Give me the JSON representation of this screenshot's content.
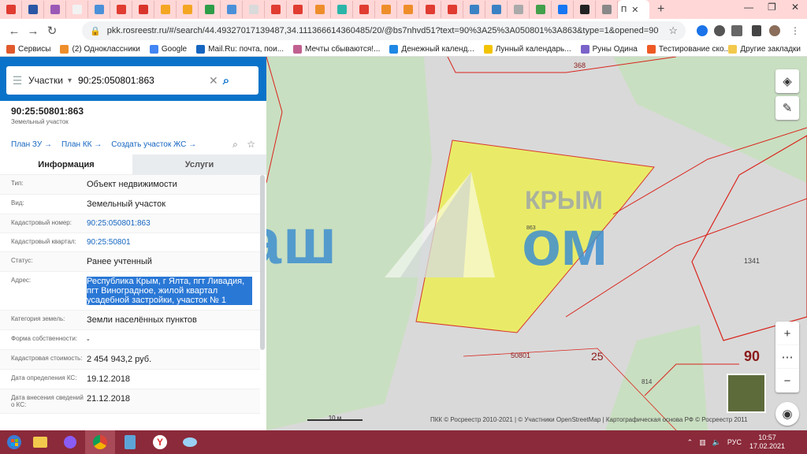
{
  "browser": {
    "tab_favicons": [
      "#e03c31",
      "#2a56a5",
      "#9b59b6",
      "#f2f2f2",
      "#4a90d9",
      "#e03c31",
      "#d9342b",
      "#f4a623",
      "#f4a623",
      "#2e9d48",
      "#4a90d9",
      "#dadada",
      "#e03c31",
      "#e03c31",
      "#ee8e2b",
      "#2bb5a8",
      "#e03c31",
      "#ee8e2b",
      "#ee8e2b",
      "#e03c31",
      "#e03c31",
      "#3b82c4",
      "#3b82c4",
      "#aaaaaa",
      "#42a04b",
      "#1877f2",
      "#222222",
      "#888888"
    ],
    "active_tab_label": "П",
    "url": "pkk.rosreestr.ru/#/search/44.49327017139487,34.111366614360485/20/@bs7nhvd51?text=90%3A25%3A050801%3A863&type=1&opened=90%3A25...",
    "bookmarks": [
      {
        "label": "Сервисы",
        "color": "#e05a2b"
      },
      {
        "label": "(2) Одноклассники",
        "color": "#ee8e2b"
      },
      {
        "label": "Google",
        "color": "#4285f4"
      },
      {
        "label": "Mail.Ru: почта, пои...",
        "color": "#1565c0"
      },
      {
        "label": "Мечты сбываются!...",
        "color": "#c06090"
      },
      {
        "label": "Денежный календ...",
        "color": "#1e88e5"
      },
      {
        "label": "Лунный календарь...",
        "color": "#f2c300"
      },
      {
        "label": "Руны Одина",
        "color": "#7a62c9"
      },
      {
        "label": "Тестирование ско...",
        "color": "#ee5a24"
      }
    ],
    "other_bookmarks": "Другие закладки"
  },
  "search": {
    "type": "Участки",
    "value": "90:25:050801:863"
  },
  "object": {
    "title": "90:25:50801:863",
    "subtitle": "Земельный участок",
    "links": [
      "План ЗУ →",
      "План КК →",
      "Создать участок ЖС →"
    ]
  },
  "tabs": {
    "info": "Информация",
    "services": "Услуги"
  },
  "rows": [
    {
      "key": "Тип:",
      "value": "Объект недвижимости",
      "style": ""
    },
    {
      "key": "Вид:",
      "value": "Земельный участок",
      "style": ""
    },
    {
      "key": "Кадастровый номер:",
      "value": "90:25:050801:863",
      "style": "link"
    },
    {
      "key": "Кадастровый квартал:",
      "value": "90:25:50801",
      "style": "link"
    },
    {
      "key": "Статус:",
      "value": "Ранее учтенный",
      "style": ""
    },
    {
      "key": "Адрес:",
      "value": "Республика Крым, г Ялта, пгт Ливадия, пгт Виноградное, жилой квартал усадебной застройки, участок № 1",
      "style": "hl"
    },
    {
      "key": "Категория земель:",
      "value": "Земли населённых пунктов",
      "style": ""
    },
    {
      "key": "Форма собственности:",
      "value": "-",
      "style": ""
    },
    {
      "key": "Кадастровая стоимость:",
      "value": "2 454 943,2 руб.",
      "style": ""
    },
    {
      "key": "Дата определения КС:",
      "value": "19.12.2018",
      "style": ""
    },
    {
      "key": "Дата внесения сведений о КС:",
      "value": "21.12.2018",
      "style": ""
    }
  ],
  "map": {
    "labels": {
      "l368": "368",
      "l863": "863",
      "l1341": "1341",
      "l50801": "50801",
      "l25": "25",
      "l90": "90",
      "l814": "814"
    },
    "scale": "10 м",
    "attribution": "ПКК © Росреестр 2010-2021 | © Участники OpenStreetMap | Картографическая основа РФ © Росреестр 2011",
    "watermark": {
      "left": "Ваш",
      "right": "ом",
      "top": "КРЫМ"
    }
  },
  "taskbar": {
    "lang": "РУС",
    "time": "10:57",
    "date": "17.02.2021"
  }
}
